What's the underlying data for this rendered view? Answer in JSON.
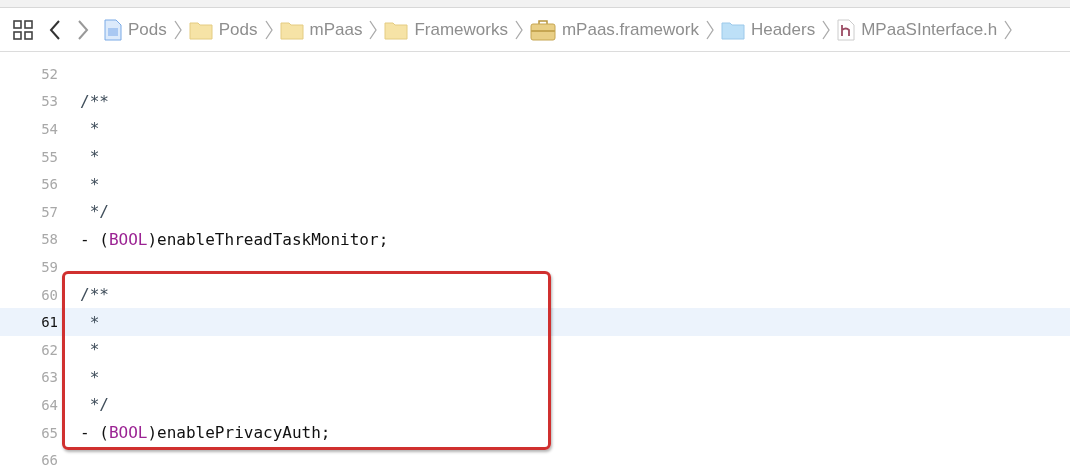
{
  "breadcrumb": [
    {
      "kind": "doc",
      "label": "Pods"
    },
    {
      "kind": "folder",
      "label": "Pods"
    },
    {
      "kind": "folder",
      "label": "mPaas"
    },
    {
      "kind": "folder",
      "label": "Frameworks"
    },
    {
      "kind": "toolbox",
      "label": "mPaas.framework"
    },
    {
      "kind": "bluefolder",
      "label": "Headers"
    },
    {
      "kind": "header",
      "label": "MPaaSInterface.h"
    }
  ],
  "editor": {
    "lines": [
      {
        "number": "52",
        "selected": false
      },
      {
        "number": "53",
        "selected": false,
        "tokens": [
          {
            "kind": "comment",
            "text": "/**"
          }
        ]
      },
      {
        "number": "54",
        "selected": false,
        "tokens": [
          {
            "kind": "comment",
            "text": " *"
          }
        ]
      },
      {
        "number": "55",
        "selected": false,
        "tokens": [
          {
            "kind": "comment",
            "text": " *"
          }
        ]
      },
      {
        "number": "56",
        "selected": false,
        "tokens": [
          {
            "kind": "comment",
            "text": " *"
          }
        ]
      },
      {
        "number": "57",
        "selected": false,
        "tokens": [
          {
            "kind": "comment",
            "text": " */"
          }
        ]
      },
      {
        "number": "58",
        "selected": false,
        "tokens": [
          {
            "kind": "plain",
            "text": "- ("
          },
          {
            "kind": "keyword",
            "text": "BOOL"
          },
          {
            "kind": "plain",
            "text": ")enableThreadTaskMonitor;"
          }
        ]
      },
      {
        "number": "59",
        "selected": false
      },
      {
        "number": "60",
        "selected": false,
        "tokens": [
          {
            "kind": "comment",
            "text": "/**"
          }
        ]
      },
      {
        "number": "61",
        "selected": true,
        "tokens": [
          {
            "kind": "comment",
            "text": " *"
          }
        ]
      },
      {
        "number": "62",
        "selected": false,
        "tokens": [
          {
            "kind": "comment",
            "text": " *"
          }
        ]
      },
      {
        "number": "63",
        "selected": false,
        "tokens": [
          {
            "kind": "comment",
            "text": " *"
          }
        ]
      },
      {
        "number": "64",
        "selected": false,
        "tokens": [
          {
            "kind": "comment",
            "text": " */"
          }
        ]
      },
      {
        "number": "65",
        "selected": false,
        "tokens": [
          {
            "kind": "plain",
            "text": "- ("
          },
          {
            "kind": "keyword",
            "text": "BOOL"
          },
          {
            "kind": "plain",
            "text": ")enablePrivacyAuth;"
          }
        ]
      },
      {
        "number": "66",
        "selected": false
      }
    ],
    "highlight": {
      "color": "#d0302f"
    }
  }
}
